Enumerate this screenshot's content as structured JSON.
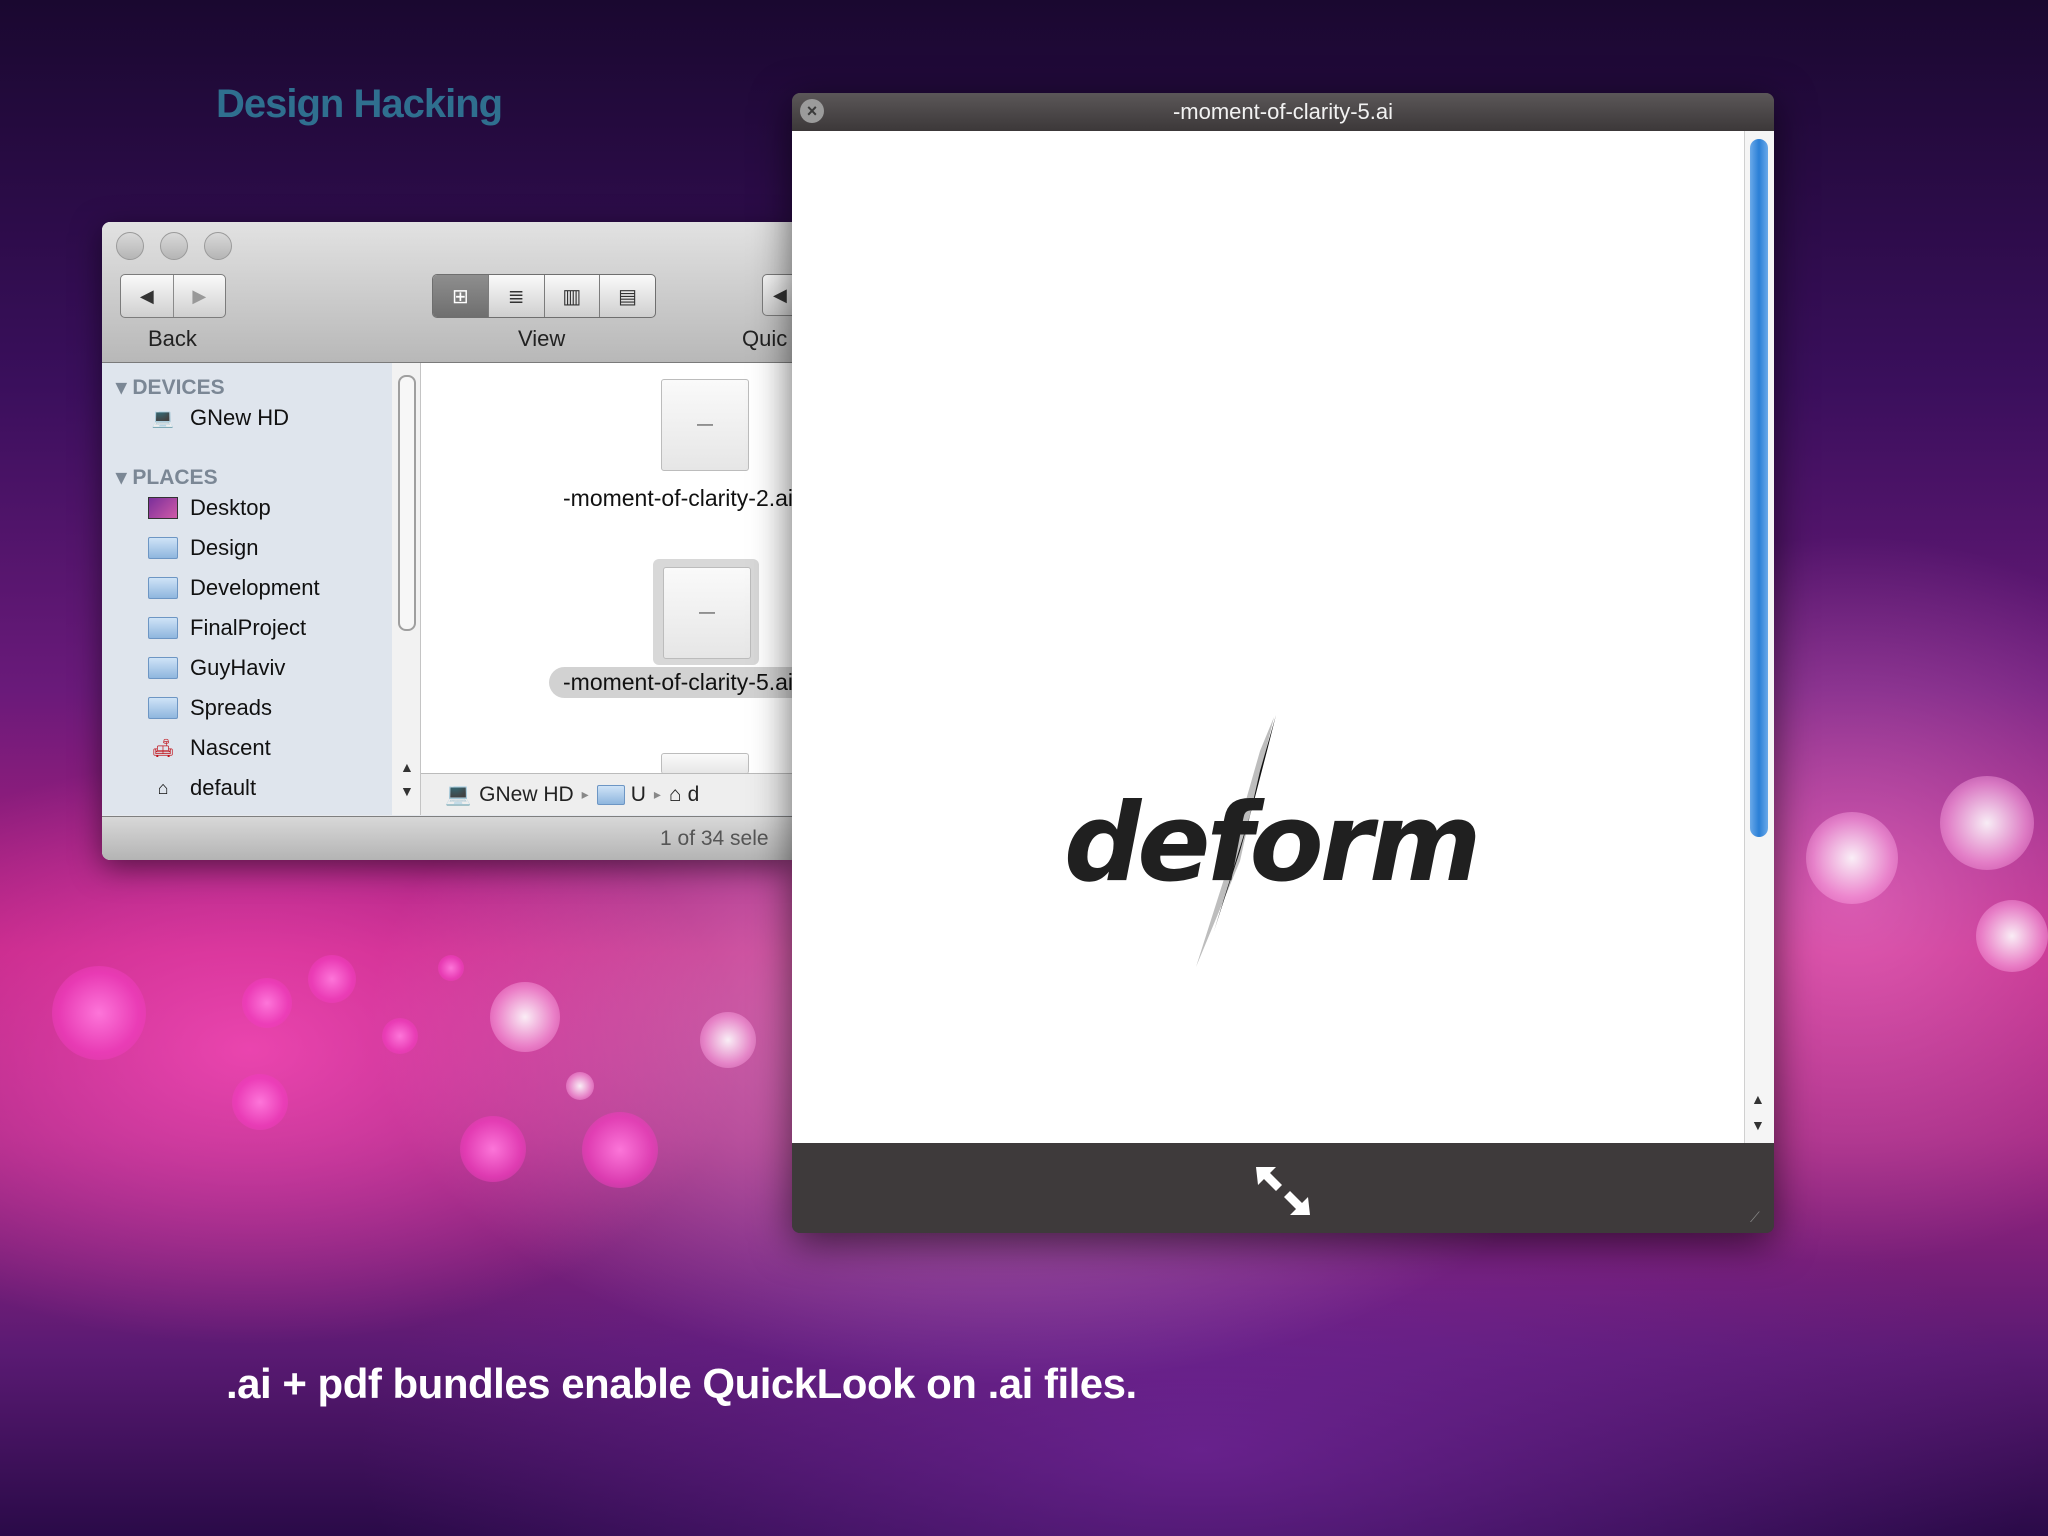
{
  "slide": {
    "title": "Design Hacking",
    "caption": ".ai + pdf bundles enable QuickLook on .ai files."
  },
  "finder": {
    "toolbar": {
      "back_label": "Back",
      "view_label": "View",
      "quicklook_label": "Quic",
      "nav_back_icon": "◀",
      "nav_forward_icon": "▶",
      "view_icons": [
        "⊞",
        "≣",
        "▥",
        "▤"
      ],
      "quicklook_icon": "◀"
    },
    "sidebar": {
      "devices_header": "DEVICES",
      "devices": [
        {
          "label": "GNew HD",
          "icon": "laptop-icon"
        }
      ],
      "places_header": "PLACES",
      "places": [
        {
          "label": "Desktop",
          "icon": "desktop-icon"
        },
        {
          "label": "Design",
          "icon": "folder-icon"
        },
        {
          "label": "Development",
          "icon": "folder-icon"
        },
        {
          "label": "FinalProject",
          "icon": "folder-icon"
        },
        {
          "label": "GuyHaviv",
          "icon": "folder-icon"
        },
        {
          "label": "Spreads",
          "icon": "folder-icon"
        },
        {
          "label": "Nascent",
          "icon": "sofa-icon"
        },
        {
          "label": "default",
          "icon": "home-icon"
        }
      ]
    },
    "files": [
      {
        "name": "-moment-of-clarity-2.ai",
        "selected": false
      },
      {
        "name": "-moment-of-clarity-5.ai",
        "selected": true
      }
    ],
    "pathbar": {
      "disk": "GNew HD",
      "folder": "U",
      "home": "d"
    },
    "status": "1 of 34 sele"
  },
  "quicklook": {
    "title": "-moment-of-clarity-5.ai",
    "logo_text": "deform",
    "accent_color": "#2a7fd6"
  }
}
